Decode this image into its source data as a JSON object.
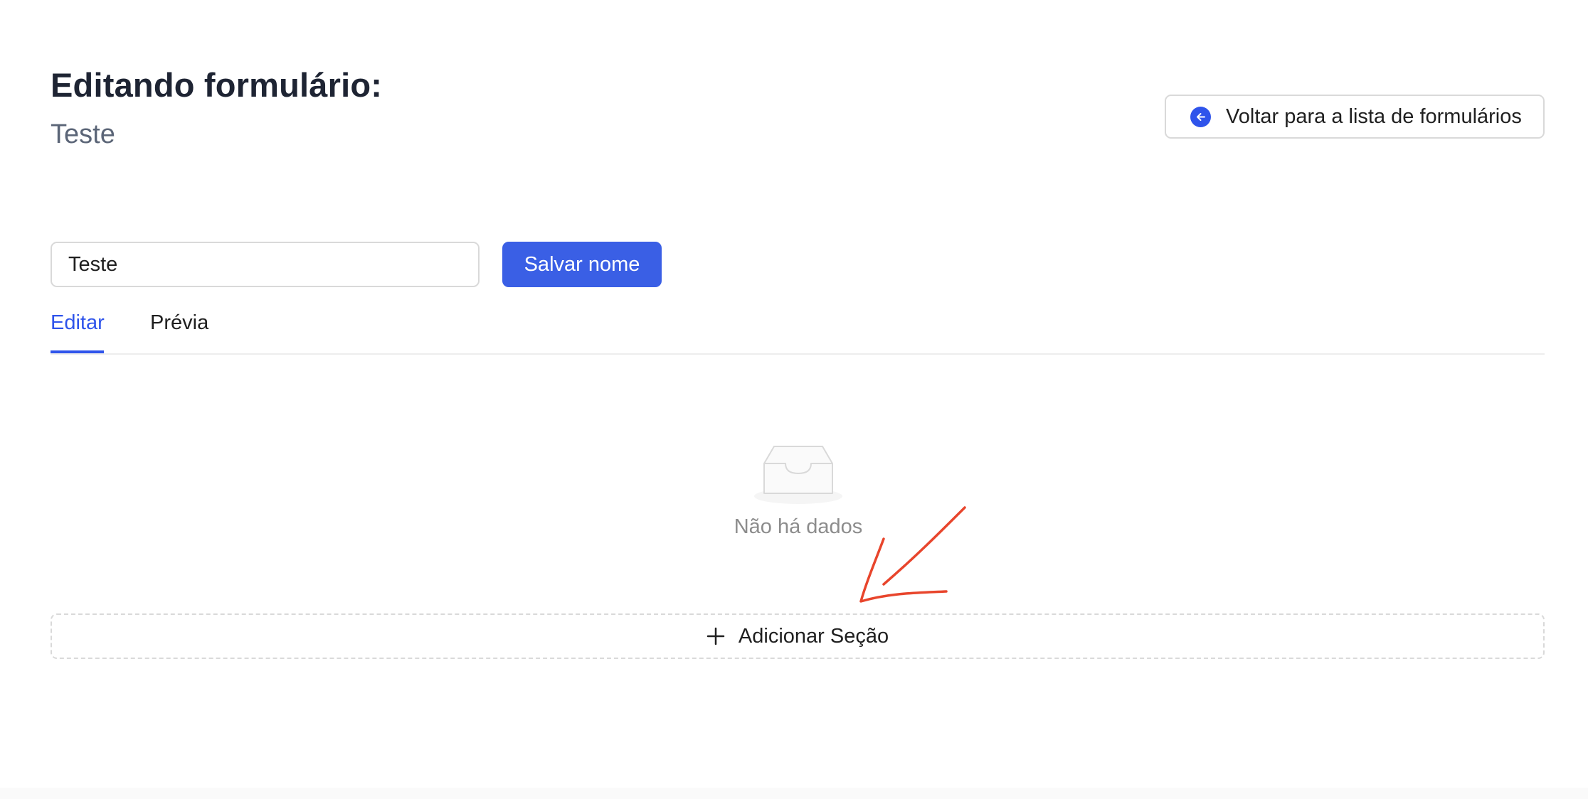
{
  "header": {
    "title": "Editando formulário:",
    "subtitle": "Teste",
    "back_button_label": "Voltar para a lista de formulários"
  },
  "form_name": {
    "input_value": "Teste",
    "save_label": "Salvar nome"
  },
  "tabs": [
    {
      "label": "Editar",
      "active": true
    },
    {
      "label": "Prévia",
      "active": false
    }
  ],
  "empty_state": {
    "text": "Não há dados",
    "icon": "empty-inbox-icon"
  },
  "add_section": {
    "label": "Adicionar Seção",
    "icon": "plus-icon"
  },
  "annotation": {
    "icon": "red-arrow-annotation",
    "color": "#e8452c"
  },
  "colors": {
    "primary": "#2f54eb",
    "button_primary": "#3a5fe5",
    "title": "#1e2433",
    "muted": "#8c8c8c",
    "border": "#d9d9d9"
  }
}
